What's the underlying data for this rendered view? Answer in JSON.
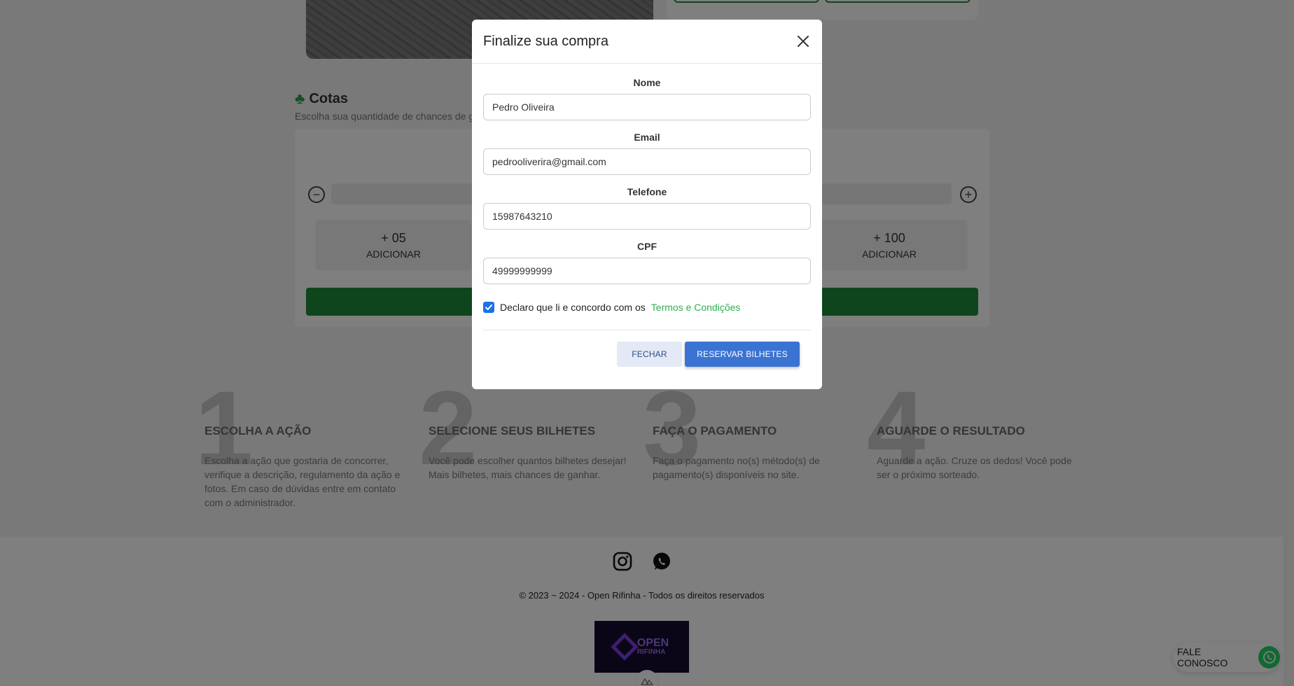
{
  "modal": {
    "title": "Finalize sua compra",
    "fields": [
      {
        "label": "Nome",
        "value": "Pedro Oliveira"
      },
      {
        "label": "Email",
        "value": "pedrooliverira@gmail.com"
      },
      {
        "label": "Telefone",
        "value": "15987643210"
      },
      {
        "label": "CPF",
        "value": "49999999999"
      }
    ],
    "terms_checked": true,
    "terms_text": "Declaro que li e concordo com os",
    "terms_link": "Termos e Condições",
    "close_label": "FECHAR",
    "submit_label": "RESERVAR BILHETES",
    "accent_color": "#3b73d3"
  },
  "cotas": {
    "title": "Cotas",
    "icon": "clover-icon",
    "subtitle": "Escolha sua quantidade de chances de g",
    "tiles": [
      {
        "amount": "+ 05",
        "label": "ADICIONAR"
      },
      {
        "amount": "+ 100",
        "label": "ADICIONAR"
      }
    ]
  },
  "steps": [
    {
      "number": "1",
      "title": "ESCOLHA A AÇÃO",
      "text": "Escolha a ação que gostaria de concorrer, verifique a descrição, regulamento da ação e fotos. Em caso de dúvidas entre em contato com o administrador."
    },
    {
      "number": "2",
      "title": "SELECIONE SEUS BILHETES",
      "text": "Você pode escolher quantos bilhetes desejar! Mais bilhetes, mais chances de ganhar."
    },
    {
      "number": "3",
      "title": "FAÇA O PAGAMENTO",
      "text": "Faça o pagamento no(s) método(s) de pagamento(s) disponíveis no site."
    },
    {
      "number": "4",
      "title": "AGUARDE O RESULTADO",
      "text": "Aguarde a ação. Cruze os dedos! Você pode ser o próximo sorteado."
    }
  ],
  "footer": {
    "copyright": "© 2023 ~ 2024 - Open Rifinha - Todos os direitos reservados",
    "logo_line1": "OPEN",
    "logo_line2": "RIFINHA",
    "social": [
      "instagram-icon",
      "whatsapp-icon"
    ]
  },
  "contact": {
    "label": "FALE CONOSCO",
    "color": "#25d366"
  }
}
